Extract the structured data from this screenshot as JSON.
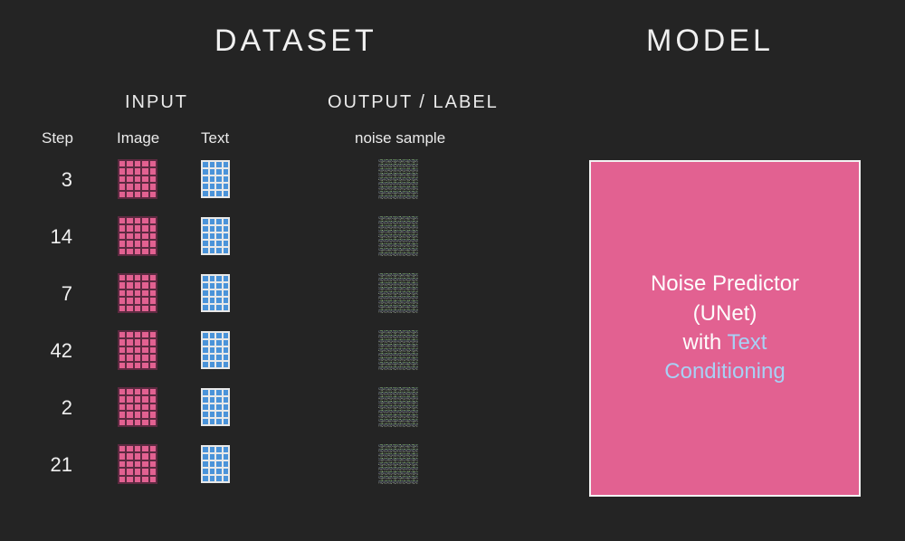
{
  "headings": {
    "dataset": "DATASET",
    "model": "MODEL",
    "input": "INPUT",
    "output": "OUTPUT  / LABEL"
  },
  "columns": {
    "step": "Step",
    "image": "Image",
    "text": "Text",
    "noise": "noise sample"
  },
  "steps": [
    "3",
    "14",
    "7",
    "42",
    "2",
    "21"
  ],
  "model_box": {
    "line1": "Noise Predictor",
    "line2": "(UNet)",
    "line3a": "with ",
    "line3b": "Text",
    "line4": "Conditioning"
  },
  "colors": {
    "background": "#242424",
    "pink": "#e26191",
    "blue_grid": "#4a93d9",
    "text_light": "#f0f0f0",
    "text_blue": "#a7d1f5"
  }
}
